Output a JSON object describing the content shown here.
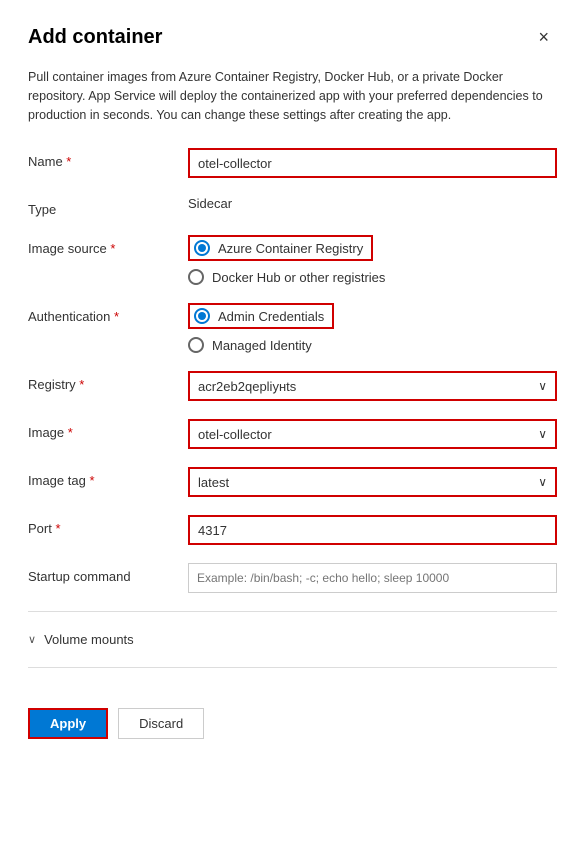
{
  "dialog": {
    "title": "Add container",
    "close_label": "×",
    "description": "Pull container images from Azure Container Registry, Docker Hub, or a private Docker repository. App Service will deploy the containerized app with your preferred dependencies to production in seconds. You can change these settings after creating the app."
  },
  "form": {
    "name_label": "Name",
    "name_required": " *",
    "name_value": "otel-collector",
    "type_label": "Type",
    "type_value": "Sidecar",
    "image_source_label": "Image source",
    "image_source_required": " *",
    "image_source_option1": "Azure Container Registry",
    "image_source_option2": "Docker Hub or other registries",
    "authentication_label": "Authentication",
    "authentication_required": " *",
    "authentication_option1": "Admin Credentials",
    "authentication_option2": "Managed Identity",
    "registry_label": "Registry",
    "registry_required": " *",
    "registry_value": "acr2eb2qepliунts",
    "registry_display": "acr2eb2qepliунts",
    "image_label": "Image",
    "image_required": " *",
    "image_value": "otel-collector",
    "image_tag_label": "Image tag",
    "image_tag_required": " *",
    "image_tag_value": "latest",
    "port_label": "Port",
    "port_required": " *",
    "port_value": "4317",
    "startup_command_label": "Startup command",
    "startup_command_placeholder": "Example: /bin/bash; -c; echo hello; sleep 10000",
    "volume_mounts_label": "Volume mounts"
  },
  "footer": {
    "apply_label": "Apply",
    "discard_label": "Discard"
  }
}
